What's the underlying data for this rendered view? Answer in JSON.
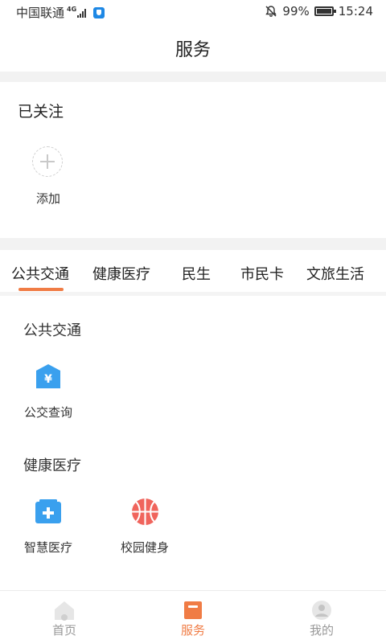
{
  "status_bar": {
    "carrier": "中国联通",
    "network": "4G",
    "battery_percent": "99%",
    "battery_level": 0.99,
    "time": "15:24"
  },
  "header": {
    "title": "服务"
  },
  "followed": {
    "title": "已关注",
    "add_label": "添加"
  },
  "tabs": [
    {
      "label": "公共交通",
      "active": true
    },
    {
      "label": "健康医疗",
      "active": false
    },
    {
      "label": "民生",
      "active": false
    },
    {
      "label": "市民卡",
      "active": false
    },
    {
      "label": "文旅生活",
      "active": false
    }
  ],
  "sections": [
    {
      "title": "公共交通",
      "items": [
        {
          "label": "公交查询",
          "icon": "bus-fare-icon"
        }
      ]
    },
    {
      "title": "健康医疗",
      "items": [
        {
          "label": "智慧医疗",
          "icon": "medical-kit-icon"
        },
        {
          "label": "校园健身",
          "icon": "basketball-icon"
        }
      ]
    }
  ],
  "bottom_nav": [
    {
      "label": "首页",
      "icon": "home-icon",
      "active": false
    },
    {
      "label": "服务",
      "icon": "service-icon",
      "active": true
    },
    {
      "label": "我的",
      "icon": "profile-icon",
      "active": false
    }
  ],
  "colors": {
    "accent": "#f07c45",
    "icon_blue": "#3aa0ee",
    "icon_red": "#f0645c",
    "inactive": "#999999"
  }
}
